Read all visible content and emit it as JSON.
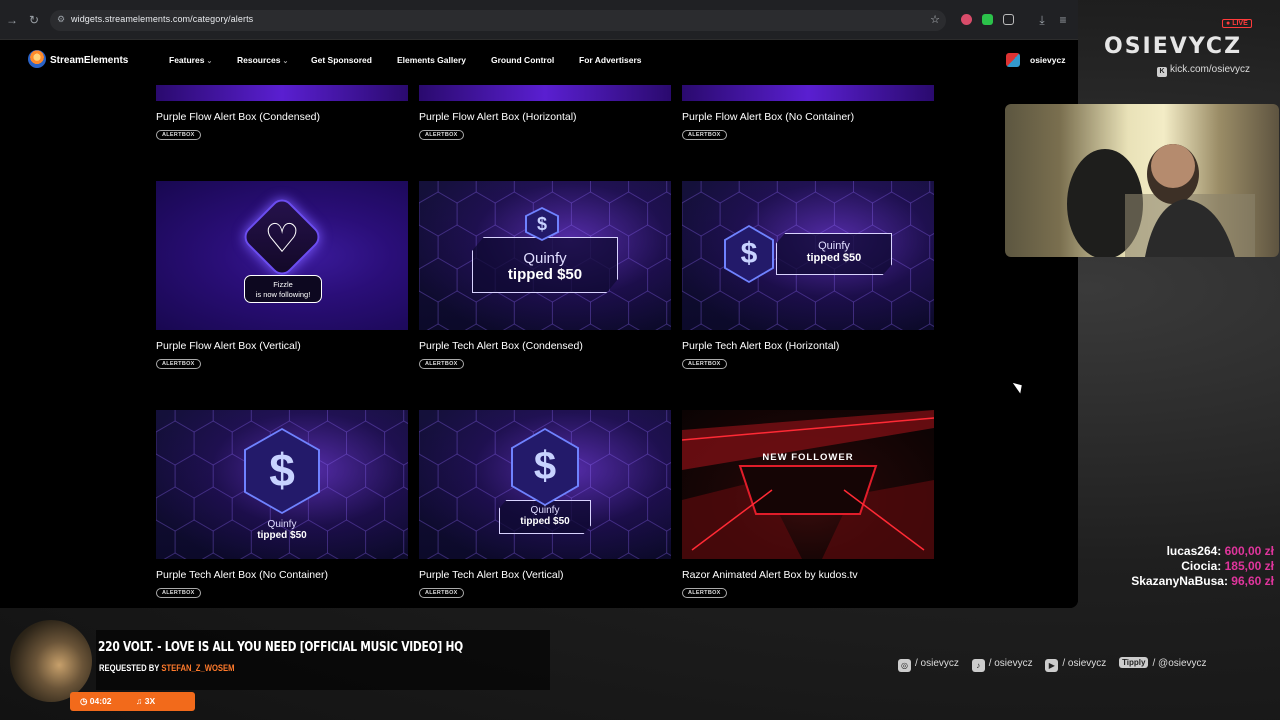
{
  "browser": {
    "url": "widgets.streamelements.com/category/alerts"
  },
  "site": {
    "brand": "StreamElements",
    "nav": [
      "Features",
      "Resources",
      "Get Sponsored",
      "Elements Gallery",
      "Ground Control",
      "For Advertisers"
    ],
    "user": "osievycz"
  },
  "cards": [
    {
      "title": "Purple Flow Alert Box (Condensed)",
      "badge": "ALERTBOX"
    },
    {
      "title": "Purple Flow Alert Box (Horizontal)",
      "badge": "ALERTBOX"
    },
    {
      "title": "Purple Flow Alert Box (No Container)",
      "badge": "ALERTBOX"
    },
    {
      "title": "Purple Flow Alert Box (Vertical)",
      "badge": "ALERTBOX"
    },
    {
      "title": "Purple Tech Alert Box (Condensed)",
      "badge": "ALERTBOX"
    },
    {
      "title": "Purple Tech Alert Box (Horizontal)",
      "badge": "ALERTBOX"
    },
    {
      "title": "Purple Tech Alert Box (No Container)",
      "badge": "ALERTBOX"
    },
    {
      "title": "Purple Tech Alert Box (Vertical)",
      "badge": "ALERTBOX"
    },
    {
      "title": "Razor Animated Alert Box by kudos.tv",
      "badge": "ALERTBOX"
    }
  ],
  "previews": {
    "fizzle_name": "Fizzle",
    "fizzle_text": "is now following!",
    "quinfy_name": "Quinfy",
    "quinfy_text": "tipped $50",
    "razor_text": "NEW FOLLOWER"
  },
  "stream": {
    "live": "LIVE",
    "channel": "OSIEVYCZ",
    "kick": "kick.com/osievycz",
    "donations": [
      {
        "user": "lucas264:",
        "amount": "600,00 zł"
      },
      {
        "user": "Ciocia:",
        "amount": "185,00 zł"
      },
      {
        "user": "SkazanyNaBusa:",
        "amount": "96,60 zł"
      }
    ],
    "song": "220 VOLT. - LOVE IS ALL YOU NEED [OFFICIAL MUSIC VIDEO] HQ",
    "requested_by_label": "REQUESTED BY",
    "requested_by": "STEFAN_Z_WOSEM",
    "song_time": "04:02",
    "song_count": "3X",
    "socials": [
      {
        "icon": "instagram-icon",
        "text": "/ osievycz"
      },
      {
        "icon": "tiktok-icon",
        "text": "/ osievycz"
      },
      {
        "icon": "youtube-icon",
        "text": "/ osievycz"
      },
      {
        "icon": "tipply-icon",
        "label": "Tipply",
        "text": "/ @osievycz"
      }
    ]
  }
}
